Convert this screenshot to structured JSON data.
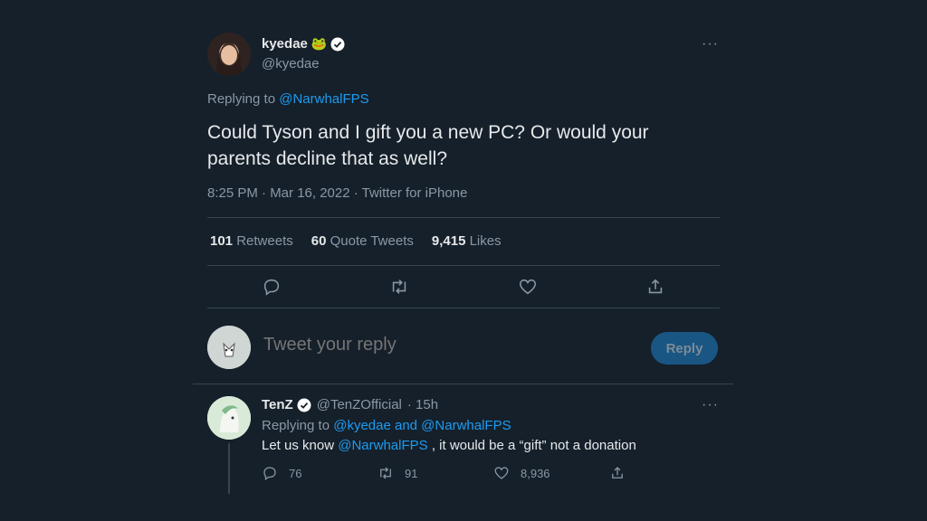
{
  "tweet": {
    "name": "kyedae",
    "name_emoji": "🐸",
    "handle": "@kyedae",
    "replying_prefix": "Replying to",
    "replying_to": "@NarwhalFPS",
    "text": "Could Tyson and I gift you a new PC? Or would your parents decline that as well?",
    "meta": "8:25 PM · Mar 16, 2022 · Twitter for iPhone",
    "stats": {
      "retweets_count": "101",
      "retweets_label": "Retweets",
      "quotes_count": "60",
      "quotes_label": "Quote Tweets",
      "likes_count": "9,415",
      "likes_label": "Likes"
    },
    "more": "···"
  },
  "compose": {
    "placeholder": "Tweet your reply",
    "button": "Reply"
  },
  "reply": {
    "name": "TenZ",
    "handle": "@TenZOfficial",
    "time": "· 15h",
    "replying_prefix": "Replying to",
    "replying_to": "@kyedae and @NarwhalFPS",
    "text_before": "Let us know",
    "mention": "@NarwhalFPS",
    "text_after": ", it would be a “gift” not a donation",
    "counts": {
      "replies": "76",
      "retweets": "91",
      "likes": "8,936"
    },
    "more": "···"
  },
  "colors": {
    "background": "#15202b",
    "accent": "#1d9bf0",
    "muted": "#8b98a5",
    "divider": "#38444d"
  },
  "icons": [
    "reply-icon",
    "retweet-icon",
    "like-icon",
    "share-icon",
    "verified-icon",
    "more-icon"
  ]
}
